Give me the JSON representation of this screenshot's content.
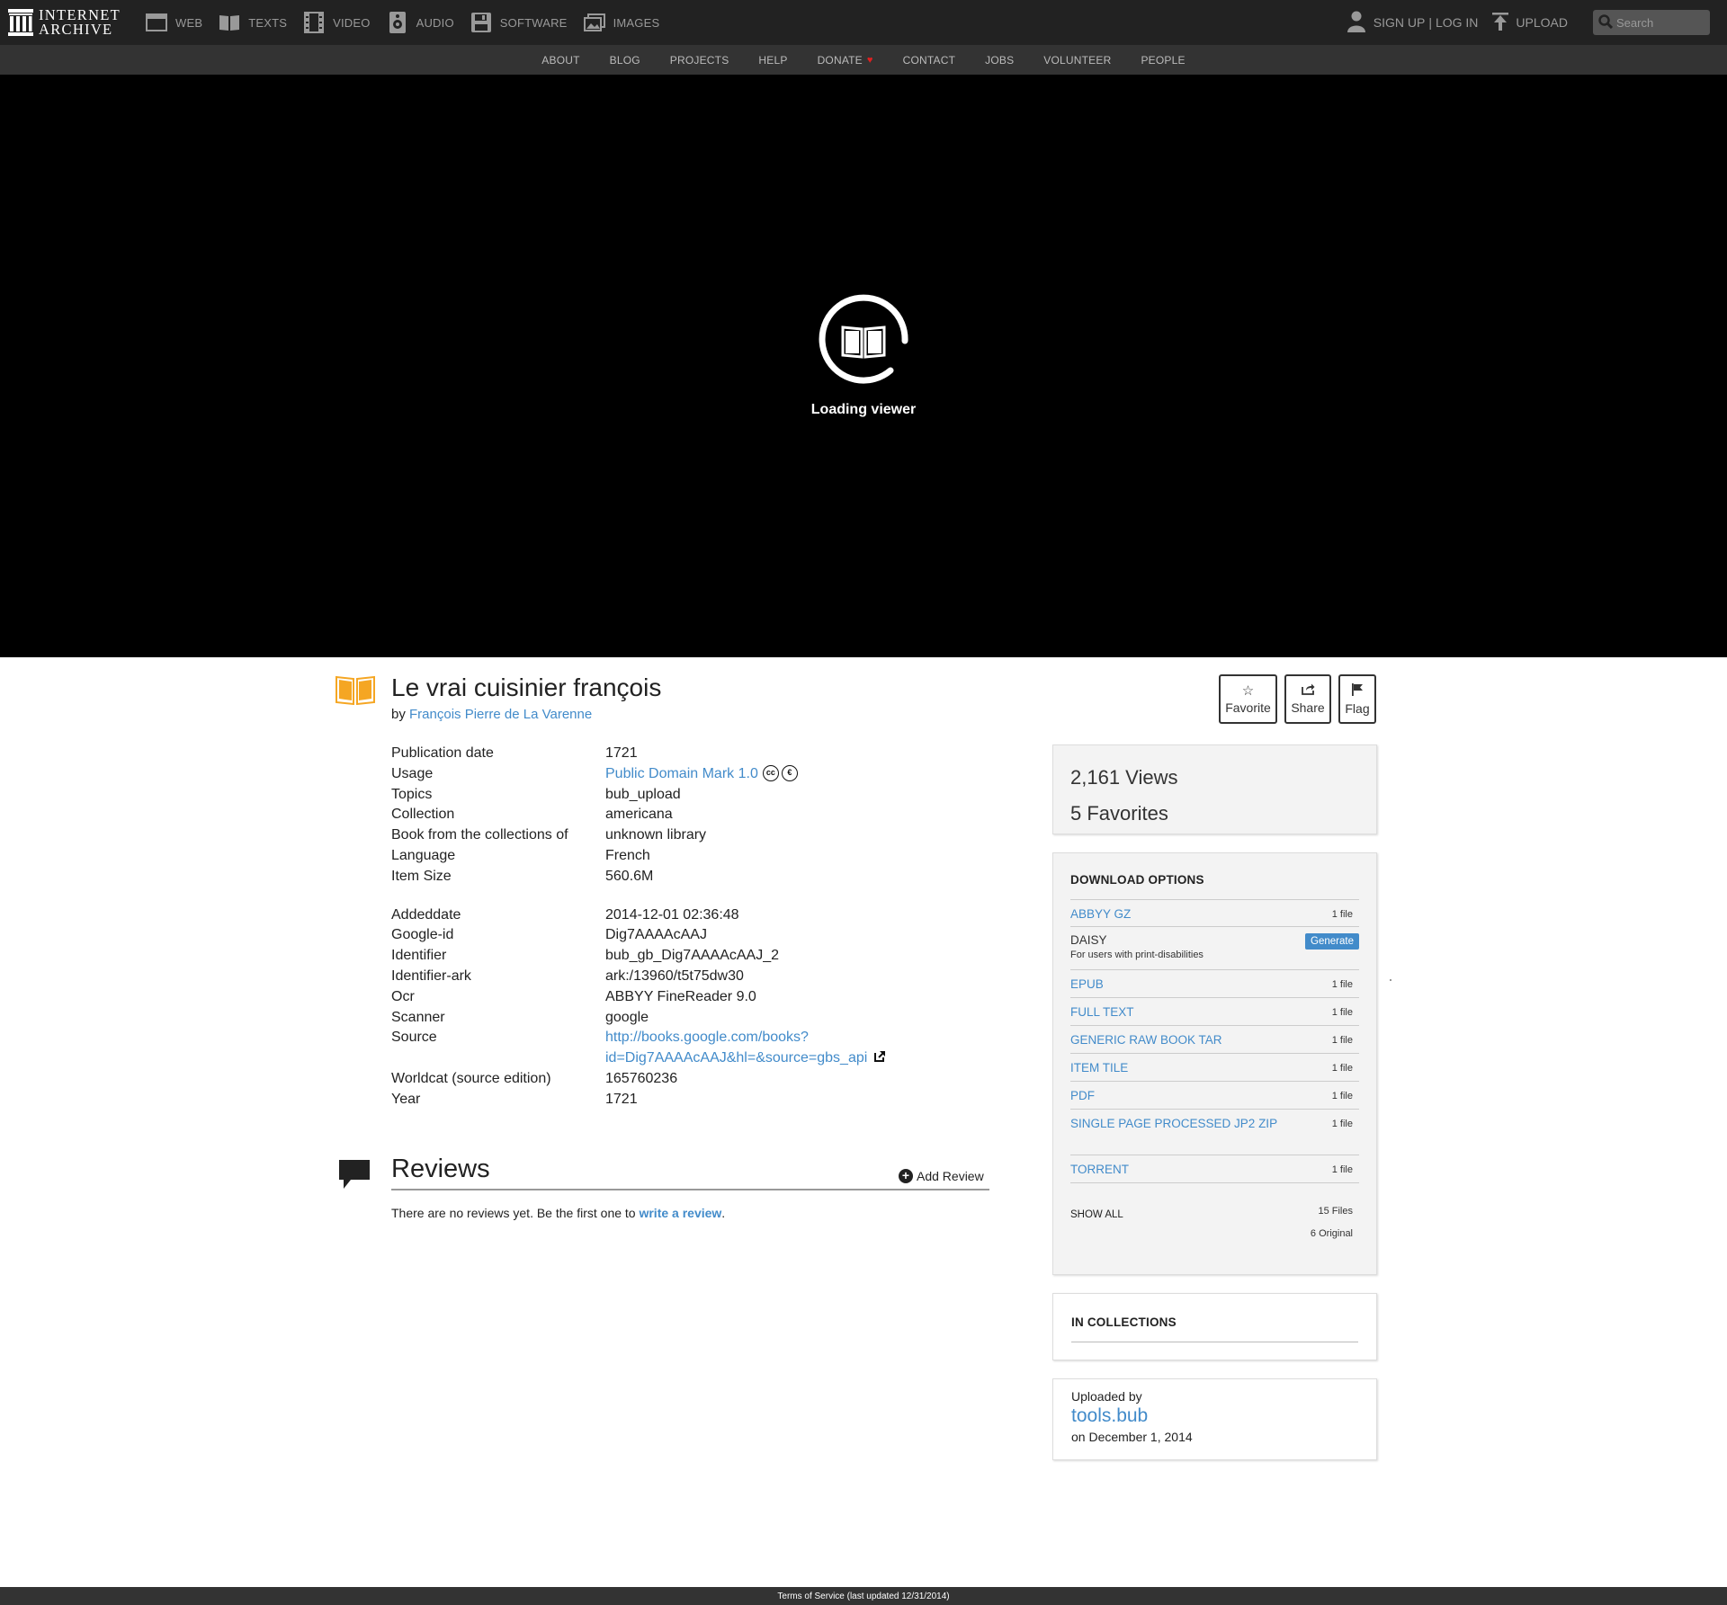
{
  "brand": {
    "logo_line1": "INTERNET",
    "logo_line2": "ARCHIVE"
  },
  "media_nav": [
    {
      "label": "WEB",
      "icon": "web-icon"
    },
    {
      "label": "TEXTS",
      "icon": "texts-icon"
    },
    {
      "label": "VIDEO",
      "icon": "video-icon"
    },
    {
      "label": "AUDIO",
      "icon": "audio-icon"
    },
    {
      "label": "SOFTWARE",
      "icon": "software-icon"
    },
    {
      "label": "IMAGES",
      "icon": "images-icon"
    }
  ],
  "user_nav": {
    "signup": "SIGN UP",
    "separator": "|",
    "login": "LOG IN",
    "upload": "UPLOAD",
    "search_placeholder": "Search"
  },
  "sub_nav": [
    "ABOUT",
    "BLOG",
    "PROJECTS",
    "HELP",
    "DONATE",
    "CONTACT",
    "JOBS",
    "VOLUNTEER",
    "PEOPLE"
  ],
  "viewer": {
    "loading_text": "Loading viewer"
  },
  "item": {
    "title": "Le vrai cuisinier françois",
    "by_prefix": "by",
    "author": "François Pierre de La Varenne"
  },
  "actions": {
    "favorite": "Favorite",
    "share": "Share",
    "flag": "Flag"
  },
  "metadata": {
    "pubdate_k": "Publication date",
    "pubdate_v": "1721",
    "usage_k": "Usage",
    "usage_v": "Public Domain Mark 1.0",
    "topics_k": "Topics",
    "topics_v": "bub_upload",
    "collection_k": "Collection",
    "collection_v": "americana",
    "from_k": "Book from the collections of",
    "from_v": "unknown library",
    "language_k": "Language",
    "language_v": "French",
    "size_k": "Item Size",
    "size_v": "560.6M",
    "addeddate_k": "Addeddate",
    "addeddate_v": "2014-12-01 02:36:48",
    "googleid_k": "Google-id",
    "googleid_v": "Dig7AAAAcAAJ",
    "identifier_k": "Identifier",
    "identifier_v": "bub_gb_Dig7AAAAcAAJ_2",
    "ark_k": "Identifier-ark",
    "ark_v": "ark:/13960/t5t75dw30",
    "ocr_k": "Ocr",
    "ocr_v": "ABBYY FineReader 9.0",
    "scanner_k": "Scanner",
    "scanner_v": "google",
    "source_k": "Source",
    "source_v1": "http://books.google.com/books?",
    "source_v2": "id=Dig7AAAAcAAJ&hl=&source=gbs_api",
    "worldcat_k": "Worldcat (source edition)",
    "worldcat_v": "165760236",
    "year_k": "Year",
    "year_v": "1721"
  },
  "reviews": {
    "title": "Reviews",
    "add_label": "Add Review",
    "empty_prefix": "There are no reviews yet. Be the first one to",
    "empty_link": "write a review",
    "empty_suffix": "."
  },
  "stats": {
    "views": "2,161 Views",
    "favorites": "5 Favorites"
  },
  "downloads": {
    "heading": "DOWNLOAD OPTIONS",
    "abbyy": "ABBYY GZ",
    "abbyy_count": "1 file",
    "daisy": "DAISY",
    "daisy_sub": "For users with print-disabilities",
    "daisy_button": "Generate",
    "epub": "EPUB",
    "epub_count": "1 file",
    "fulltext": "FULL TEXT",
    "fulltext_count": "1 file",
    "rawtar": "GENERIC RAW BOOK TAR",
    "rawtar_count": "1 file",
    "tile": "ITEM TILE",
    "tile_count": "1 file",
    "pdf": "PDF",
    "pdf_count": "1 file",
    "jp2": "SINGLE PAGE PROCESSED JP2 ZIP",
    "jp2_count": "1 file",
    "torrent": "TORRENT",
    "torrent_count": "1 file",
    "show_all": "SHOW ALL",
    "total_files": "15 Files",
    "original": "6 Original"
  },
  "collections": {
    "heading": "IN COLLECTIONS"
  },
  "uploader": {
    "label": "Uploaded by",
    "name": "tools.bub",
    "date": "on December 1, 2014"
  },
  "footer": {
    "tos": "Terms of Service (last updated 12/31/2014)"
  },
  "colors": {
    "link": "#428bca",
    "topbar": "#222222",
    "subnav": "#333333",
    "donate_heart": "#e02020",
    "item_icon": "#f5a623"
  }
}
